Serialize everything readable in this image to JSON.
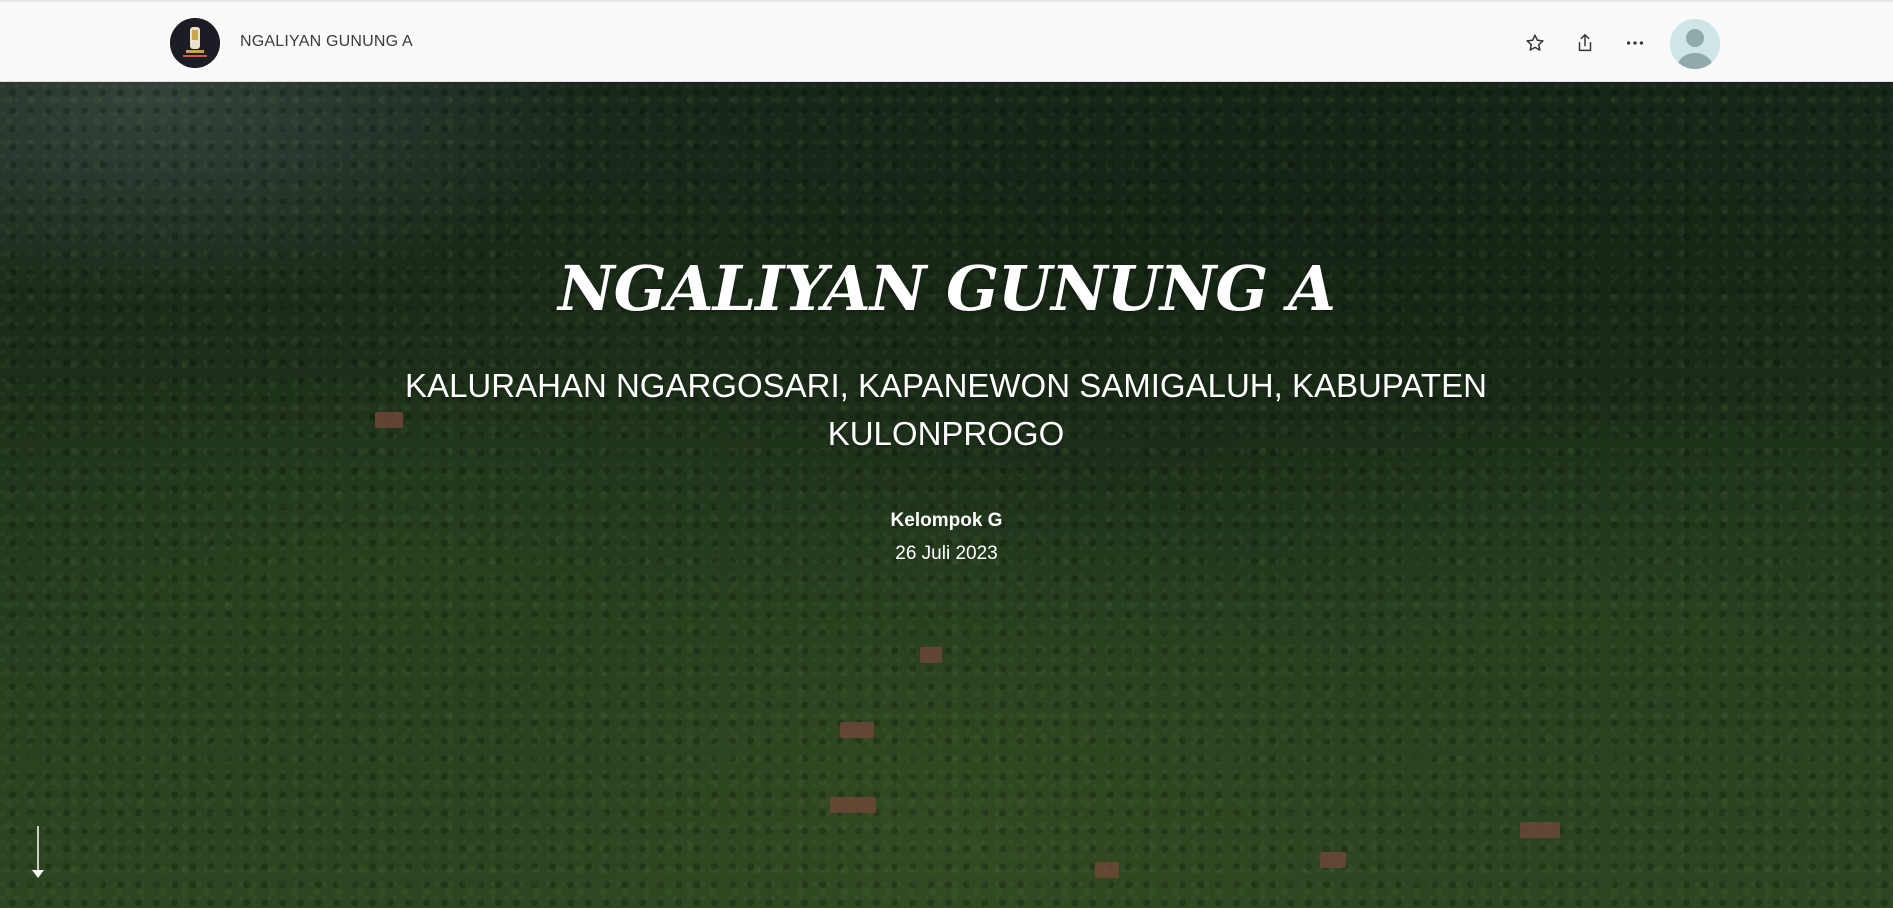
{
  "header": {
    "site_title": "NGALIYAN GUNUNG A",
    "logo_icon": "university-seal-logo",
    "actions": [
      {
        "name": "favorite",
        "icon": "star-icon"
      },
      {
        "name": "share",
        "icon": "share-icon"
      },
      {
        "name": "more",
        "icon": "more-options-icon"
      }
    ],
    "avatar_icon": "user-avatar-icon"
  },
  "hero": {
    "title": "NGALIYAN GUNUNG A",
    "subtitle": "KALURAHAN NGARGOSARI, KAPANEWON SAMIGALUH, KABUPATEN KULONPROGO",
    "author": "Kelompok G",
    "date": "26 Juli 2023",
    "background": "aerial-forest-village-photo",
    "scroll_icon": "arrow-down-icon"
  },
  "colors": {
    "topbar_bg": "#fafafa",
    "text_dark": "#3b3b3b",
    "hero_text": "#ffffff",
    "avatar_bg": "#cfe6e8"
  }
}
